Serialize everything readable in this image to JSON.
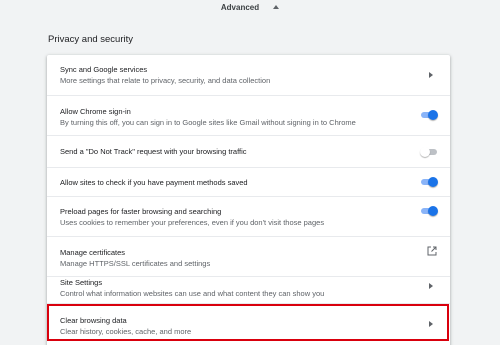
{
  "advanced": {
    "label": "Advanced",
    "icon": "chevron-up-icon"
  },
  "section": {
    "title": "Privacy and security"
  },
  "rows": [
    {
      "label": "Sync and Google services",
      "sub": "More settings that relate to privacy, security, and data collection",
      "control": "arrow"
    },
    {
      "label": "Allow Chrome sign-in",
      "sub": "By turning this off, you can sign in to Google sites like Gmail without signing in to Chrome",
      "control": "toggle",
      "state": "on"
    },
    {
      "label": "Send a \"Do Not Track\" request with your browsing traffic",
      "control": "toggle",
      "state": "off"
    },
    {
      "label": "Allow sites to check if you have payment methods saved",
      "control": "toggle",
      "state": "on"
    },
    {
      "label": "Preload pages for faster browsing and searching",
      "sub": "Uses cookies to remember your preferences, even if you don't visit those pages",
      "control": "toggle",
      "state": "on"
    },
    {
      "label": "Manage certificates",
      "sub": "Manage HTTPS/SSL certificates and settings",
      "control": "external-link"
    },
    {
      "label": "Site Settings",
      "sub": "Control what information websites can use and what content they can show you",
      "control": "arrow"
    },
    {
      "label": "Clear browsing data",
      "sub": "Clear history, cookies, cache, and more",
      "control": "arrow",
      "highlighted": true
    }
  ],
  "colors": {
    "accent": "#1a73e8",
    "highlight_border": "#d9000d",
    "background": "#f1f3f4"
  }
}
